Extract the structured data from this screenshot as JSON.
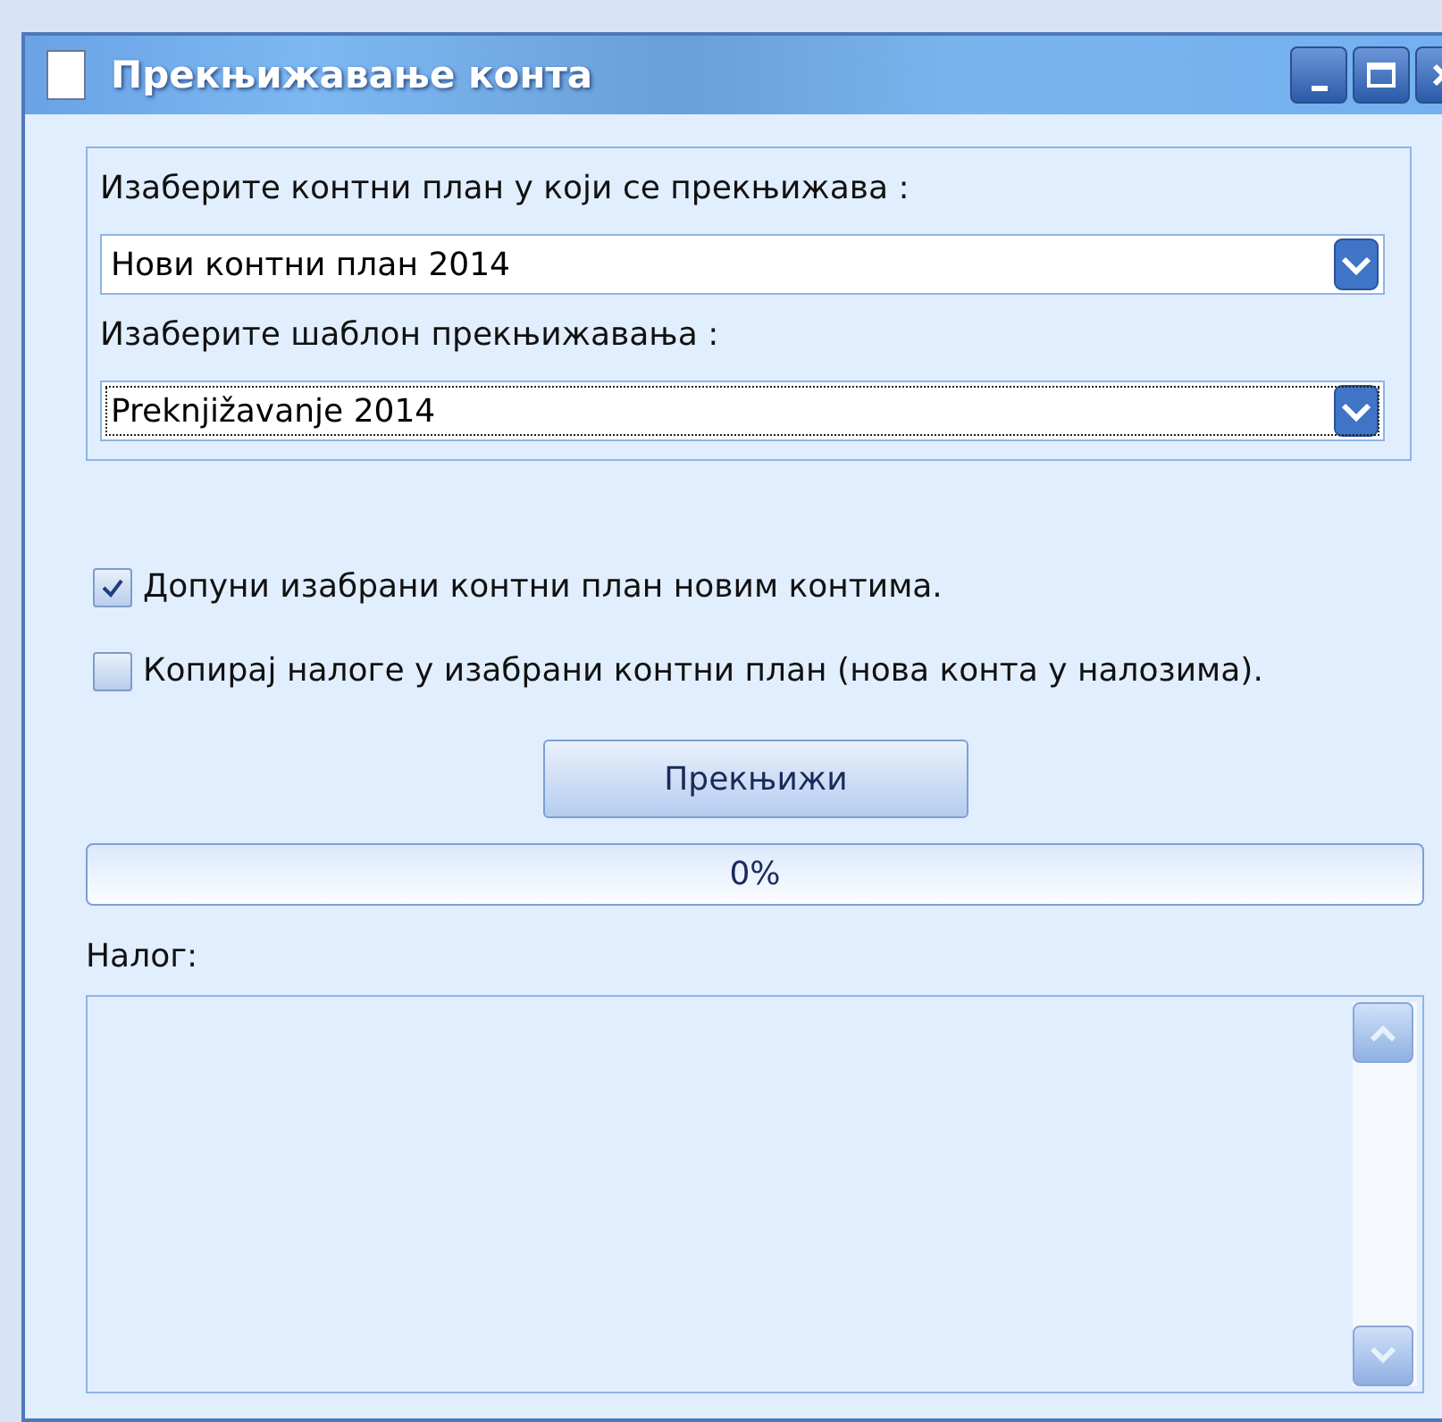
{
  "window": {
    "title": "Прекњижавање конта"
  },
  "plan_select": {
    "label": "Изаберите контни план у који се прекњижава :",
    "value": "Нови контни план 2014",
    "focused": false
  },
  "template_select": {
    "label": "Изаберите шаблон прекњижавања :",
    "value": "Preknjižavanje 2014",
    "focused": true
  },
  "options": [
    {
      "label": "Допуни изабрани контни план новим контима.",
      "checked": true
    },
    {
      "label": "Копирај налоге у изабрани контни план (нова конта у налозима).",
      "checked": false
    }
  ],
  "button": "Прекњижи",
  "progress": {
    "level": 0,
    "reading": "0%"
  },
  "log": {
    "label": "Налог:"
  }
}
